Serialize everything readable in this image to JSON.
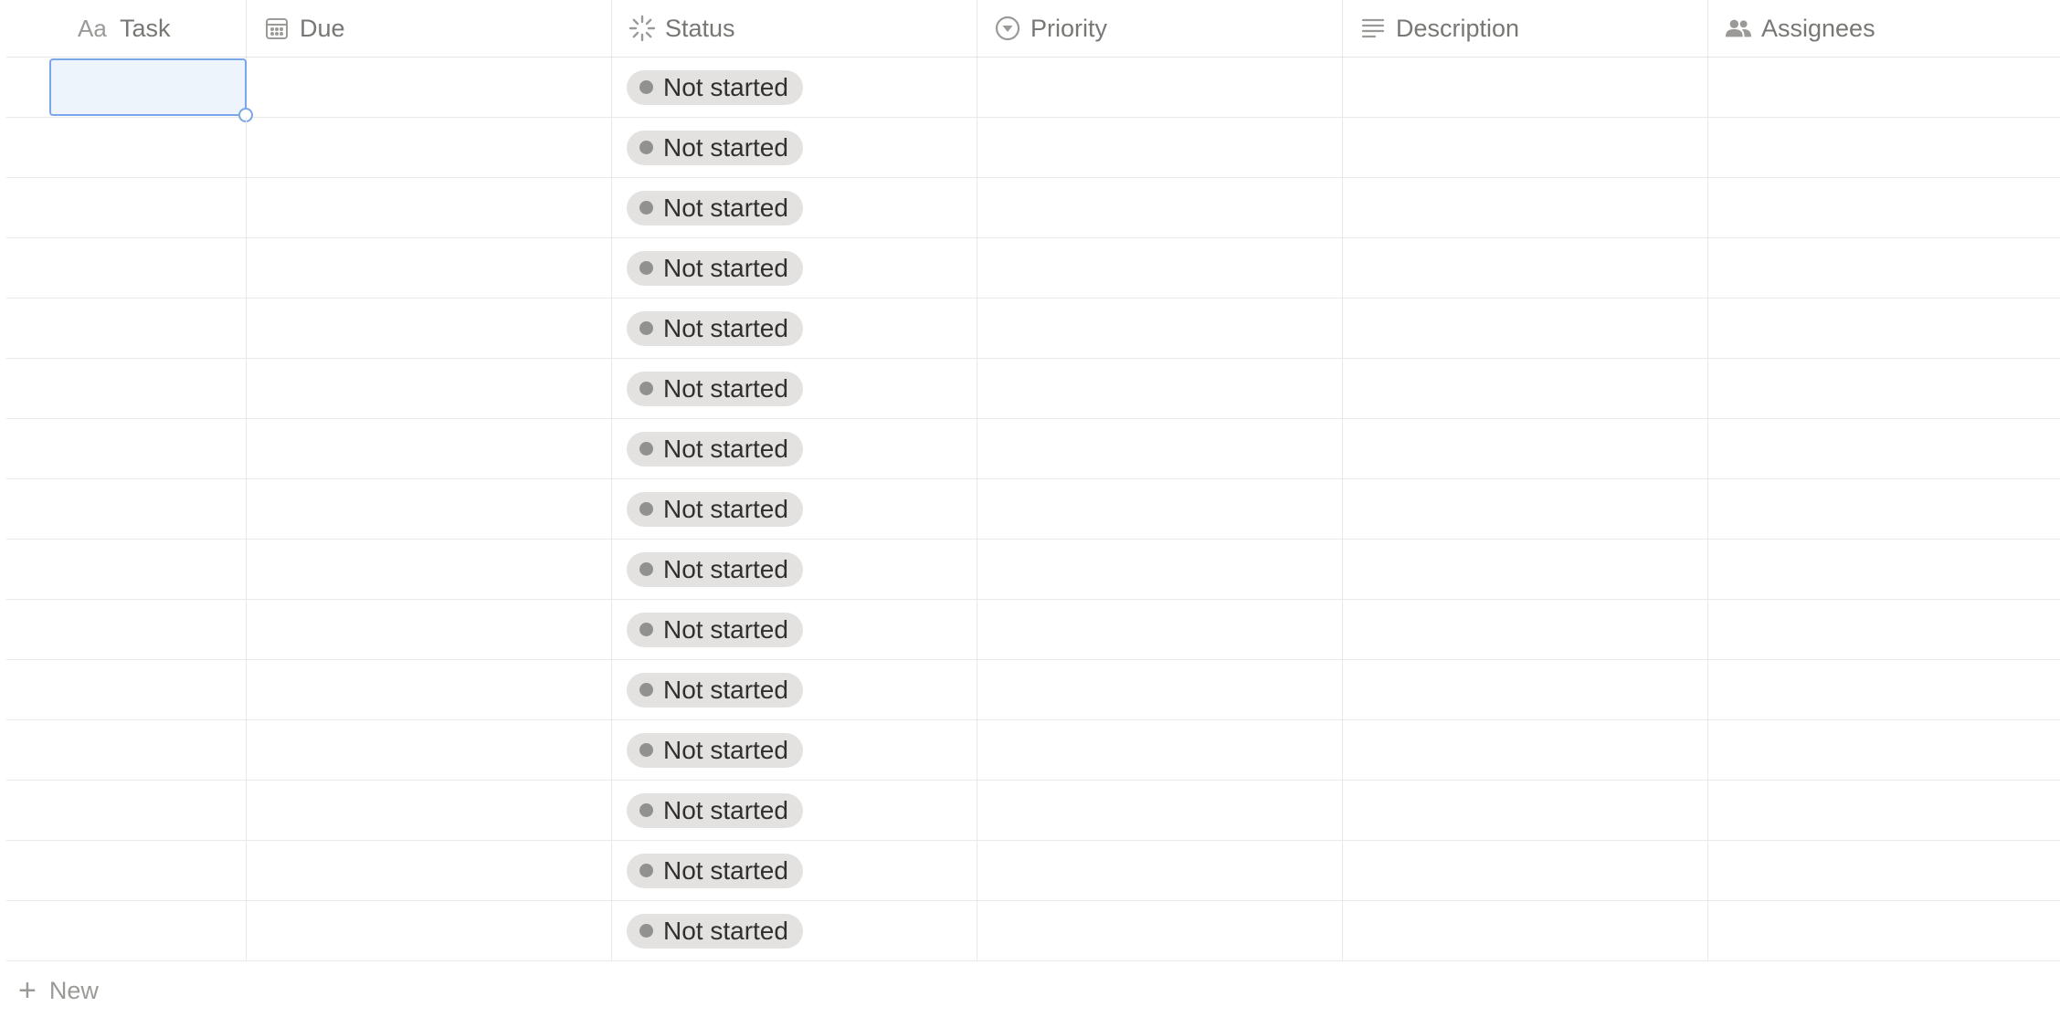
{
  "columns": {
    "task": {
      "label": "Task",
      "icon": "Aa"
    },
    "due": {
      "label": "Due"
    },
    "status": {
      "label": "Status"
    },
    "priority": {
      "label": "Priority"
    },
    "description": {
      "label": "Description"
    },
    "assignees": {
      "label": "Assignees"
    }
  },
  "rows": [
    {
      "status": "Not started"
    },
    {
      "status": "Not started"
    },
    {
      "status": "Not started"
    },
    {
      "status": "Not started"
    },
    {
      "status": "Not started"
    },
    {
      "status": "Not started"
    },
    {
      "status": "Not started"
    },
    {
      "status": "Not started"
    },
    {
      "status": "Not started"
    },
    {
      "status": "Not started"
    },
    {
      "status": "Not started"
    },
    {
      "status": "Not started"
    },
    {
      "status": "Not started"
    },
    {
      "status": "Not started"
    },
    {
      "status": "Not started"
    }
  ],
  "new_row": {
    "label": "New"
  },
  "colors": {
    "status_pill_bg": "#e3e2e0",
    "status_dot": "#91918e",
    "selection": "#7aa7e8"
  }
}
